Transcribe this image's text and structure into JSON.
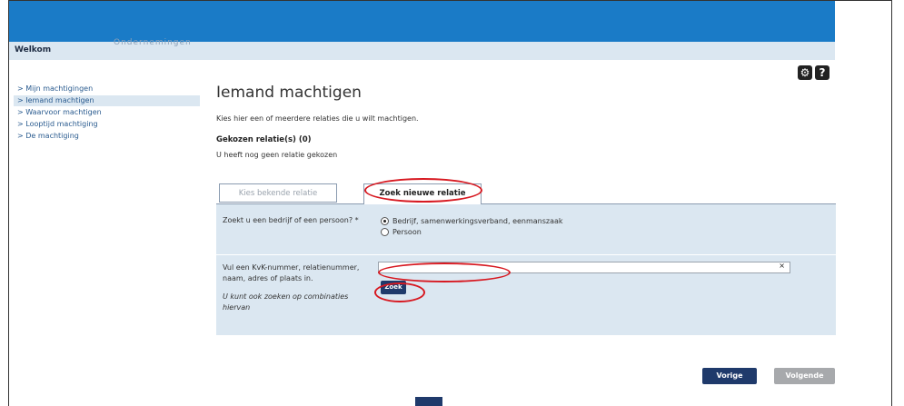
{
  "header": {
    "welcome": "Welkom",
    "welcome_faded": "Ondernemingen"
  },
  "tools": {
    "settings_icon": "gear-icon",
    "help_label": "?"
  },
  "sidebar": {
    "items": [
      {
        "label": "> Mijn machtigingen",
        "active": false
      },
      {
        "label": "> Iemand machtigen",
        "active": true
      },
      {
        "label": "> Waarvoor machtigen",
        "active": false
      },
      {
        "label": "> Looptijd machtiging",
        "active": false
      },
      {
        "label": "> De machtiging",
        "active": false
      }
    ]
  },
  "main": {
    "title": "Iemand machtigen",
    "intro": "Kies hier een of meerdere relaties die u wilt machtigen.",
    "chosen_title": "Gekozen relatie(s) (0)",
    "chosen_note": "U heeft nog geen relatie gekozen",
    "tabs": [
      {
        "label": "Kies bekende relatie",
        "active": false
      },
      {
        "label": "Zoek nieuwe relatie",
        "active": true
      }
    ],
    "form": {
      "question_label": "Zoekt u een bedrijf of een persoon? *",
      "options": [
        {
          "label": "Bedrijf, samenwerkingsverband, eenmanszaak",
          "checked": true
        },
        {
          "label": "Persoon",
          "checked": false
        }
      ],
      "search_label": "Vul een KvK-nummer, relatienummer, naam, adres of plaats in.",
      "search_hint": "U kunt ook zoeken op combinaties hiervan",
      "search_value": "",
      "clear_symbol": "×",
      "search_button": "Zoek"
    }
  },
  "footer": {
    "prev_button": "Vorige",
    "next_button": "Volgende"
  },
  "colors": {
    "topbar": "#1a7bc7",
    "panel": "#dbe7f1",
    "primary_button": "#1f3a6b",
    "disabled_button": "#a7a9ac",
    "highlight": "#d71921"
  }
}
